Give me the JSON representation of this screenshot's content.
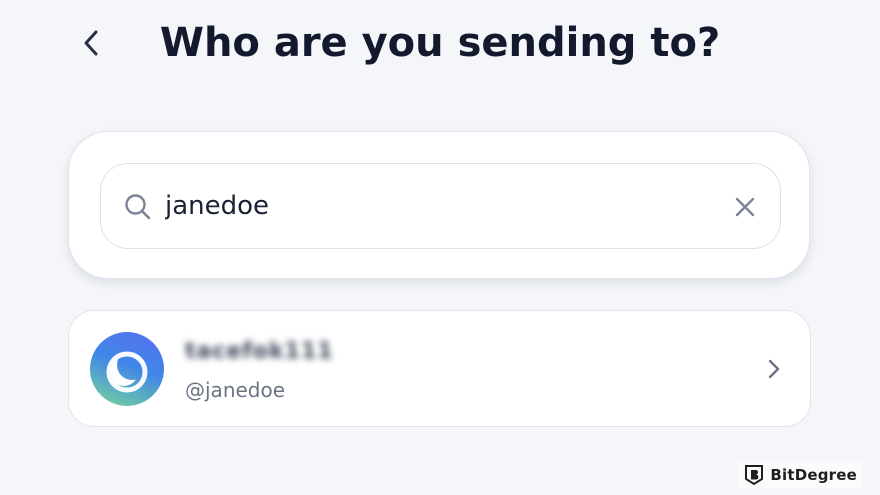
{
  "header": {
    "title": "Who are you sending to?",
    "back_icon": "chevron-left-icon"
  },
  "search": {
    "value": "janedoe",
    "search_icon": "search-icon",
    "clear_icon": "close-icon"
  },
  "results": [
    {
      "display_name": "tacefok111",
      "username": "@janedoe",
      "avatar_icon": "crescent-moon-avatar",
      "chevron_icon": "chevron-right-icon"
    }
  ],
  "watermark": {
    "text": "BitDegree",
    "logo": "bitdegree-logo"
  },
  "colors": {
    "background": "#f4f6fa",
    "title": "#141a2e",
    "avatar_gradient_start": "#5a6ff0",
    "avatar_gradient_end": "#79d69a"
  }
}
